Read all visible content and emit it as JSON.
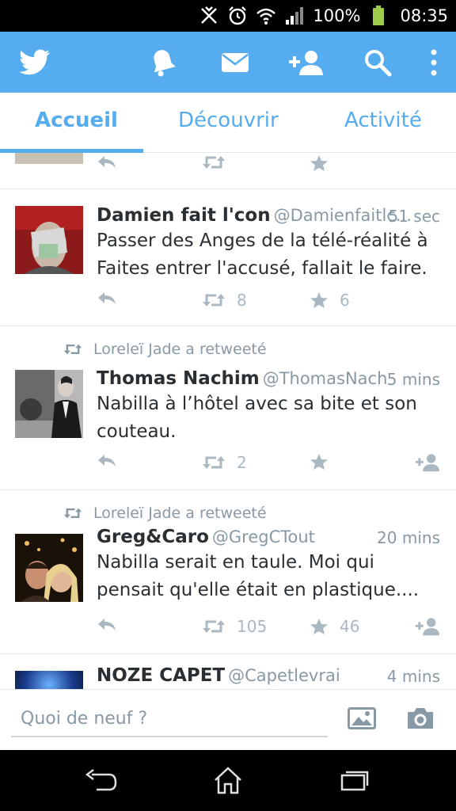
{
  "status_bar": {
    "battery_pct": "100%",
    "clock": "08:35"
  },
  "app_bar": {
    "icons": [
      "twitter-bird-icon",
      "notifications-bell-icon",
      "messages-envelope-icon",
      "add-user-icon",
      "search-icon",
      "overflow-menu-icon"
    ]
  },
  "tabs": [
    {
      "label": "Accueil",
      "active": true
    },
    {
      "label": "Découvrir",
      "active": false
    },
    {
      "label": "Activité",
      "active": false
    }
  ],
  "tweets": [
    {
      "name": "Damien fait l'con",
      "handle": "@Damienfaitlc...",
      "time": "51 sec",
      "text": "Passer des Anges de la télé-réalité à Faites entrer l'accusé, fallait le faire.",
      "retweets": "8",
      "favorites": "6"
    },
    {
      "retweeted_by": "Loreleï Jade a retweeté",
      "name": "Thomas Nachim",
      "handle": "@ThomasNach",
      "time": "5 mins",
      "text": "Nabilla à l’hôtel avec sa bite et son couteau.",
      "retweets": "2",
      "favorites": ""
    },
    {
      "retweeted_by": "Loreleï Jade a retweeté",
      "name": "Greg&Caro",
      "handle": "@GregCTout",
      "time": "20 mins",
      "text": "Nabilla serait en taule. Moi qui pensait qu'elle était en plastique....",
      "retweets": "105",
      "favorites": "46"
    },
    {
      "name": "NOZE CAPET",
      "handle": "@Capetlevrai",
      "time": "4 mins"
    }
  ],
  "compose": {
    "placeholder": "Quoi de neuf ?"
  },
  "colors": {
    "accent": "#55acee",
    "text": "#292f33",
    "muted": "#8899a6",
    "action": "#aab8c2"
  }
}
